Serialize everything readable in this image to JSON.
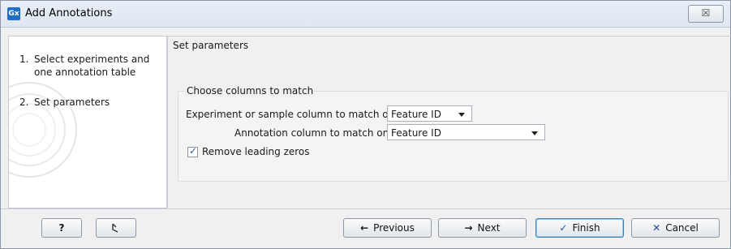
{
  "window": {
    "title": "Add Annotations",
    "app_icon_text": "Gx",
    "close_glyph": "☒"
  },
  "steps": [
    {
      "num": "1.",
      "label": "Select experiments and one annotation table"
    },
    {
      "num": "2.",
      "label": "Set parameters"
    }
  ],
  "main": {
    "section_title": "Set parameters",
    "group_title": "Choose columns to match",
    "experiment_label": "Experiment or sample column to match on",
    "experiment_value": "Feature ID",
    "annotation_label": "Annotation column to match on",
    "annotation_value": "Feature ID",
    "remove_zeros_label": "Remove leading zeros",
    "remove_zeros_checked": true
  },
  "footer": {
    "help": "?",
    "previous": "Previous",
    "next": "Next",
    "finish": "Finish",
    "cancel": "Cancel"
  }
}
